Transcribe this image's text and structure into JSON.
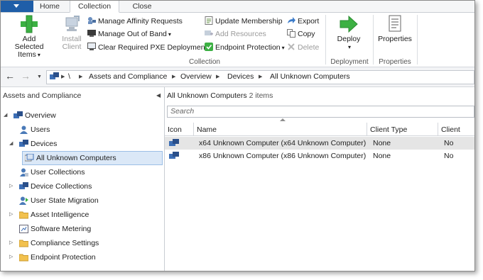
{
  "tabs": {
    "home": "Home",
    "collection": "Collection",
    "close": "Close"
  },
  "ribbon": {
    "add_selected_items": [
      "Add",
      "Selected Items"
    ],
    "install_client": [
      "Install",
      "Client"
    ],
    "manage_affinity": "Manage Affinity Requests",
    "manage_out_of_band": "Manage Out of Band",
    "clear_pxe": "Clear Required PXE Deployments",
    "update_membership": "Update Membership",
    "add_resources": "Add Resources",
    "endpoint_protection": "Endpoint Protection",
    "export": "Export",
    "copy": "Copy",
    "delete": "Delete",
    "deploy": "Deploy",
    "properties": "Properties",
    "groups": {
      "collection": "Collection",
      "deployment": "Deployment",
      "properties": "Properties"
    }
  },
  "breadcrumb": {
    "root": "\\",
    "items": [
      "Assets and Compliance",
      "Overview",
      "Devices",
      "All Unknown Computers"
    ]
  },
  "nav": {
    "header": "Assets and Compliance",
    "items": [
      {
        "label": "Overview"
      },
      {
        "label": "Users"
      },
      {
        "label": "Devices"
      },
      {
        "label": "All Unknown Computers"
      },
      {
        "label": "User Collections"
      },
      {
        "label": "Device Collections"
      },
      {
        "label": "User State Migration"
      },
      {
        "label": "Asset Intelligence"
      },
      {
        "label": "Software Metering"
      },
      {
        "label": "Compliance Settings"
      },
      {
        "label": "Endpoint Protection"
      }
    ]
  },
  "content": {
    "title": "All Unknown Computers",
    "count": "2 items",
    "search_placeholder": "Search",
    "columns": [
      "Icon",
      "Name",
      "Client Type",
      "Client"
    ],
    "rows": [
      {
        "name": "x64 Unknown Computer (x64 Unknown Computer)",
        "client_type": "None",
        "client": "No"
      },
      {
        "name": "x86 Unknown Computer (x86 Unknown Computer)",
        "client_type": "None",
        "client": "No"
      }
    ]
  },
  "colors": {
    "file_tab": "#1f5ea8",
    "selection": "#dbe8f7",
    "accent_green": "#3cb043"
  }
}
